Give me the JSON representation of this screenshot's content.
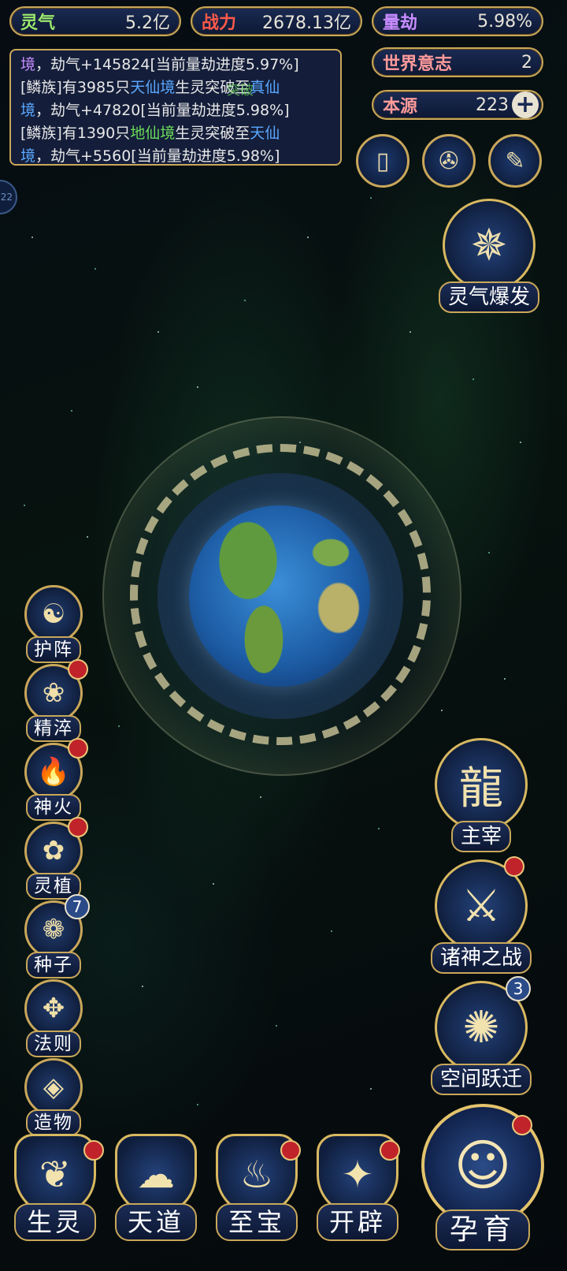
{
  "stats": {
    "lingqi": {
      "label": "灵气",
      "value": "5.2亿"
    },
    "zhanli": {
      "label": "战力",
      "value": "2678.13亿"
    },
    "liangjie": {
      "label": "量劫",
      "value": "5.98%"
    },
    "shijie": {
      "label": "世界意志",
      "value": "2"
    },
    "benyuan": {
      "label": "本源",
      "value": "223"
    }
  },
  "log": {
    "line1": {
      "a": "境",
      "b": "，劫气+145824[当前量劫进度5.97%]"
    },
    "line2": {
      "a": "[鳞族]有3985只",
      "b": "天仙境",
      "c": "生灵突破至",
      "d": "真仙",
      "e": "境",
      "f": "，劫气+47820[当前量劫进度5.98%]"
    },
    "line3": {
      "a": "[鳞族]有1390只",
      "b": "地仙境",
      "c": "生灵突破至",
      "d": "天仙",
      "e": "境",
      "f": "，劫气+5560[当前量劫进度5.98%]"
    }
  },
  "top_icons": [
    "book-icon",
    "vortex-icon",
    "scroll-icon"
  ],
  "burst": {
    "label": "灵气爆发"
  },
  "left_features": [
    {
      "label": "护阵",
      "icon": "☯"
    },
    {
      "label": "精淬",
      "icon": "❀"
    },
    {
      "label": "神火",
      "icon": "🔥"
    },
    {
      "label": "灵植",
      "icon": "✿"
    },
    {
      "label": "种子",
      "icon": "❁",
      "count": "7"
    },
    {
      "label": "法则",
      "icon": "✥"
    },
    {
      "label": "造物",
      "icon": "◈"
    }
  ],
  "right_features": [
    {
      "label": "主宰",
      "icon": "龍"
    },
    {
      "label": "诸神之战",
      "icon": "⚔"
    },
    {
      "label": "空间跃迁",
      "icon": "✺",
      "count": "3"
    }
  ],
  "bottom_nav": [
    {
      "label": "生灵",
      "icon": "❦"
    },
    {
      "label": "天道",
      "icon": "☁"
    },
    {
      "label": "至宝",
      "icon": "♨"
    },
    {
      "label": "开辟",
      "icon": "✦"
    }
  ],
  "main_action": {
    "label": "孕育",
    "icon": "☺"
  },
  "side_tab": {
    "label": "22"
  },
  "planet_label": "突破"
}
